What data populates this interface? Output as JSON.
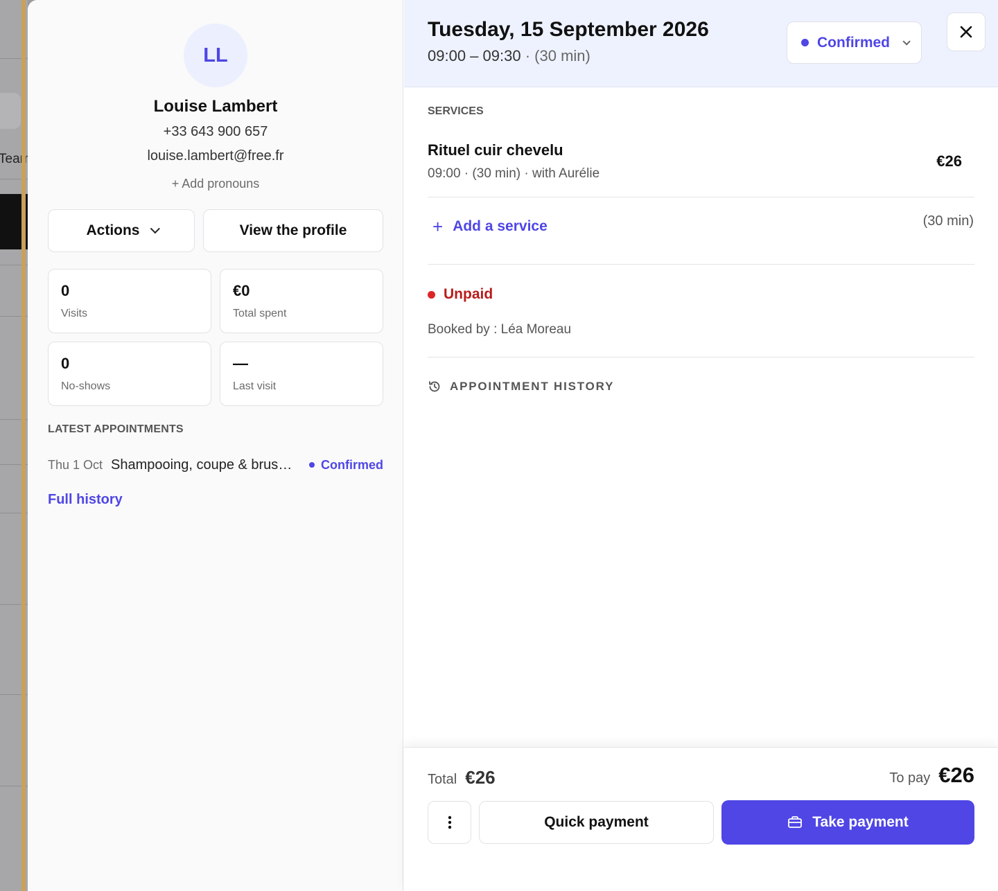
{
  "background": {
    "team_label": "Team"
  },
  "client": {
    "initials": "LL",
    "name": "Louise Lambert",
    "phone": "+33 643 900 657",
    "email": "louise.lambert@free.fr",
    "add_pronouns": "+ Add pronouns",
    "actions_label": "Actions",
    "view_profile_label": "View the profile",
    "stats": [
      {
        "value": "0",
        "label": "Visits"
      },
      {
        "value": "€0",
        "label": "Total spent"
      },
      {
        "value": "0",
        "label": "No-shows"
      },
      {
        "value": "—",
        "label": "Last visit"
      }
    ],
    "latest_title": "LATEST APPOINTMENTS",
    "latest": [
      {
        "date": "Thu 1 Oct",
        "service": "Shampooing, coupe & brushing",
        "status": "Confirmed"
      }
    ],
    "full_history_label": "Full history"
  },
  "appointment": {
    "date": "Tuesday, 15 September 2026",
    "time": "09:00 – 09:30",
    "duration": "(30 min)",
    "status": "Confirmed",
    "services_title": "SERVICES",
    "services": [
      {
        "name": "Rituel cuir chevelu",
        "meta": "09:00 · (30 min) · with Aurélie",
        "price": "€26"
      }
    ],
    "add_service_label": "Add a service",
    "add_service_duration": "(30 min)",
    "payment_status": "Unpaid",
    "booked_by": "Booked by : Léa Moreau",
    "history_label": "APPOINTMENT HISTORY"
  },
  "footer": {
    "total_label": "Total",
    "total_value": "€26",
    "to_pay_label": "To pay",
    "to_pay_value": "€26",
    "quick_payment_label": "Quick payment",
    "take_payment_label": "Take payment"
  },
  "colors": {
    "accent": "#4f46e5",
    "unpaid": "#dc2626",
    "header_bg": "#eef2fe"
  }
}
